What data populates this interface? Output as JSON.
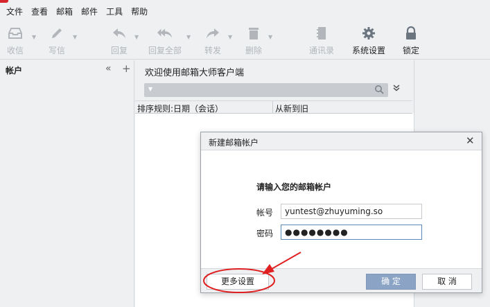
{
  "menubar": {
    "items": [
      "文件",
      "查看",
      "邮箱",
      "邮件",
      "工具",
      "帮助"
    ]
  },
  "toolbar": {
    "items": [
      {
        "label": "收信",
        "icon": "inbox-icon"
      },
      {
        "label": "写信",
        "icon": "pencil-icon"
      },
      {
        "label": "回复",
        "icon": "reply-icon"
      },
      {
        "label": "回复全部",
        "icon": "reply-all-icon"
      },
      {
        "label": "转发",
        "icon": "forward-icon"
      },
      {
        "label": "删除",
        "icon": "trash-icon"
      },
      {
        "label": "通讯录",
        "icon": "address-book-icon"
      },
      {
        "label": "系统设置",
        "icon": "gear-icon"
      },
      {
        "label": "锁定",
        "icon": "lock-icon"
      }
    ]
  },
  "sidebar": {
    "title": "帐户"
  },
  "main": {
    "welcome": "欢迎使用邮箱大师客户端",
    "sort": {
      "rule": "排序规则:日期（会话）",
      "order": "从新到旧"
    }
  },
  "dialog": {
    "title": "新建邮箱帐户",
    "heading": "请输入您的邮箱帐户",
    "account_label": "帐号",
    "account_value": "yuntest@zhuyuming.so",
    "password_label": "密码",
    "password_value": "●●●●●●●●",
    "more_settings": "更多设置",
    "ok": "确 定",
    "cancel": "取 消"
  },
  "colors": {
    "accent": "#8ba3c4",
    "annotation": "#e02020",
    "brand": "#d4262c"
  }
}
